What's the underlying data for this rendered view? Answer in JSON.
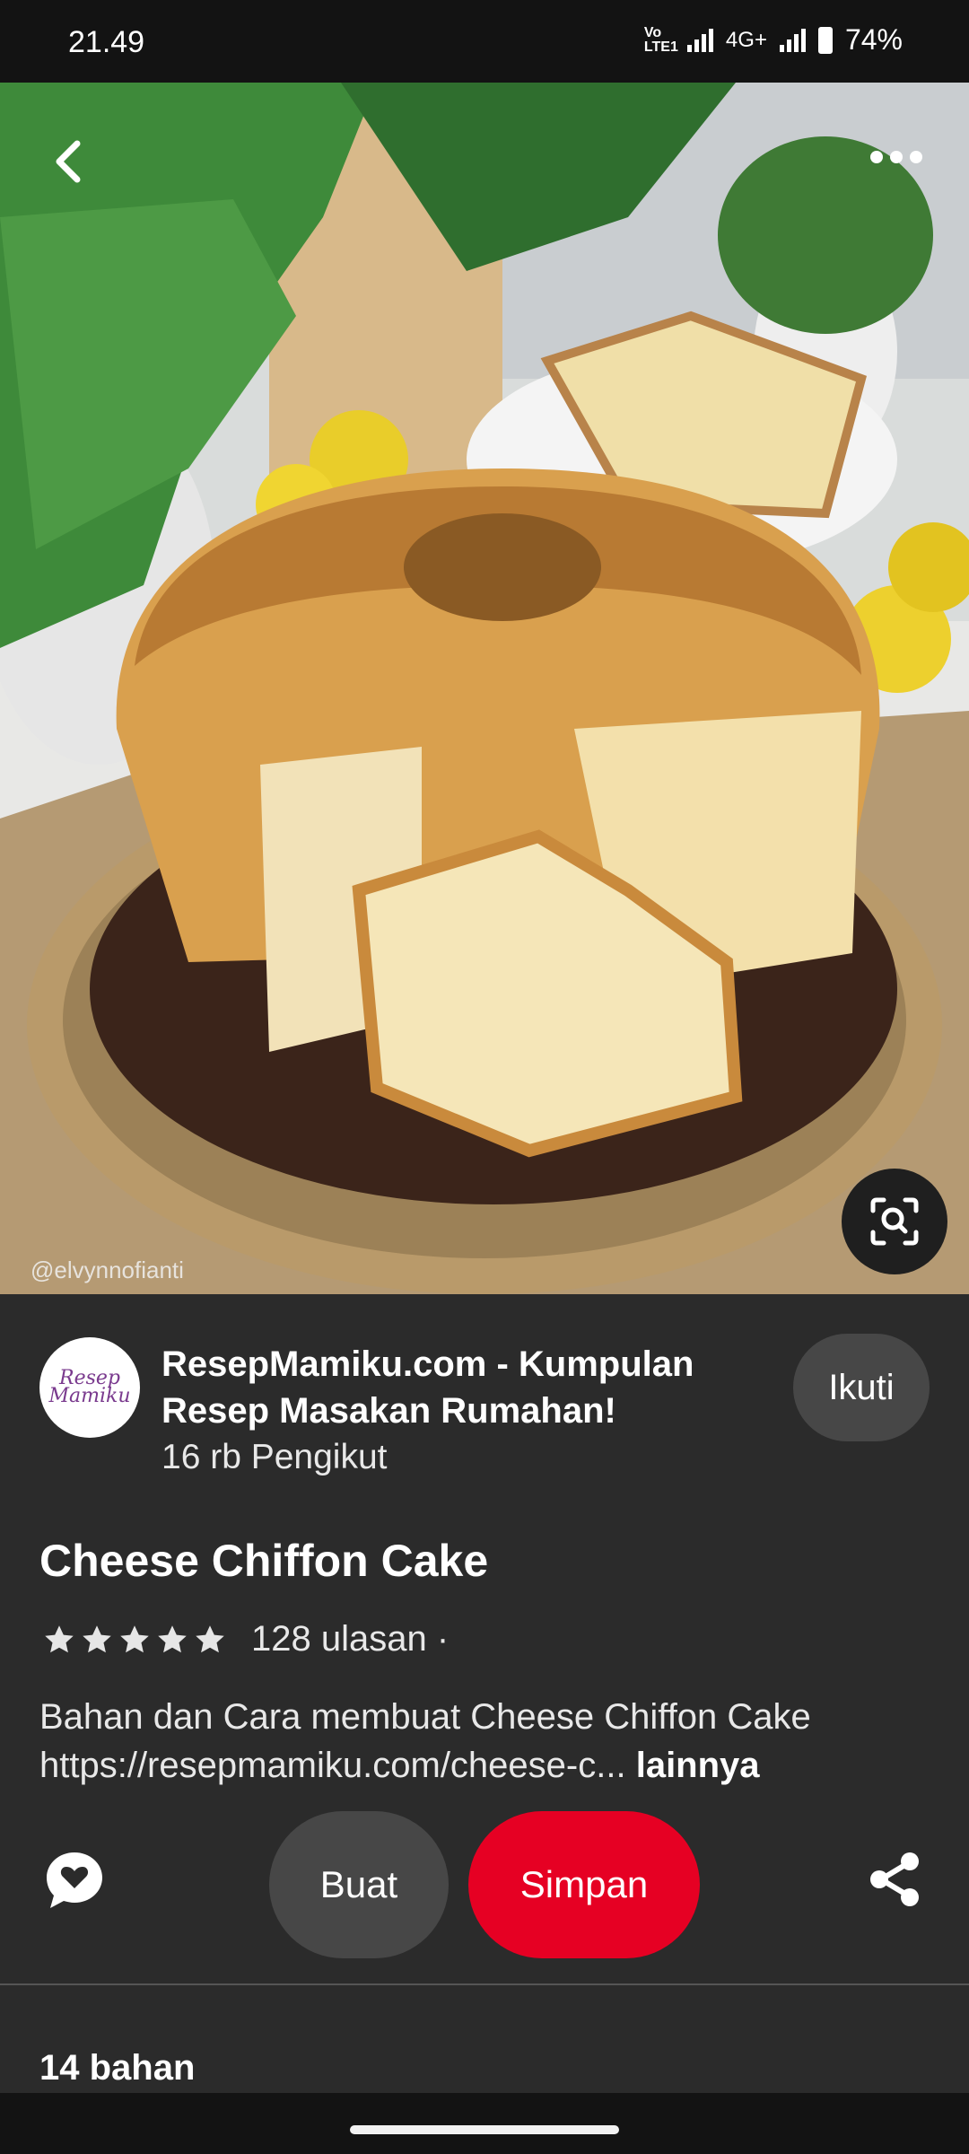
{
  "status": {
    "time": "21.49",
    "network_volte": "Vo LTE1",
    "network_type": "4G+",
    "battery": "74%"
  },
  "hero": {
    "watermark": "@elvynnofianti"
  },
  "icons": {
    "back": "chevron-left-icon",
    "more": "more-horizontal-icon",
    "lens": "visual-search-icon",
    "comment": "heart-bubble-icon",
    "share": "share-icon"
  },
  "creator": {
    "avatar_text": "Resep Mamiku",
    "name": "ResepMamiku.com - Kumpulan Resep Masakan Rumahan!",
    "followers": "16 rb Pengikut",
    "follow_label": "Ikuti"
  },
  "pin": {
    "title": "Cheese Chiffon Cake",
    "rating_stars": 5,
    "reviews": "128 ulasan ·",
    "description": "Bahan dan Cara membuat Cheese Chiffon Cake https://resepmamiku.com/cheese-c...",
    "more_label": "lainnya"
  },
  "actions": {
    "make_label": "Buat",
    "save_label": "Simpan"
  },
  "section": {
    "ingredients_count": "14 bahan"
  },
  "colors": {
    "save_red": "#e60023",
    "button_gray": "#474747",
    "background": "#2b2b2b"
  }
}
